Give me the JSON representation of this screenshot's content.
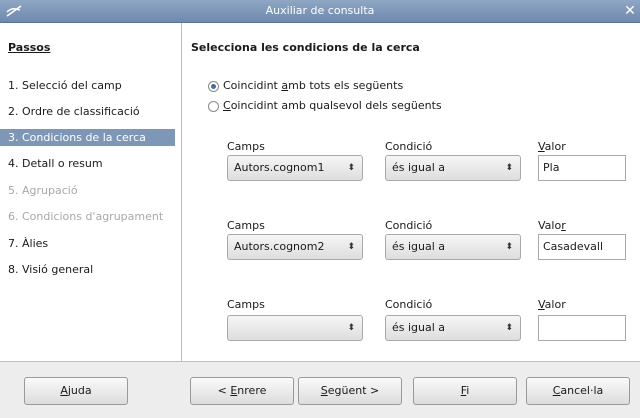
{
  "window": {
    "title": "Auxiliar de consulta",
    "close_glyph": "✕",
    "app_icon": "writer-icon"
  },
  "sidebar": {
    "heading": "Passos",
    "steps": [
      {
        "label": "1. Selecció del camp",
        "state": "normal"
      },
      {
        "label": "2. Ordre de classificació",
        "state": "normal"
      },
      {
        "label": "3. Condicions de la cerca",
        "state": "selected"
      },
      {
        "label": "4. Detall o resum",
        "state": "normal"
      },
      {
        "label": "5. Agrupació",
        "state": "disabled"
      },
      {
        "label": "6. Condicions d'agrupament",
        "state": "disabled"
      },
      {
        "label": "7. Àlies",
        "state": "normal"
      },
      {
        "label": "8. Visió general",
        "state": "normal"
      }
    ]
  },
  "main": {
    "heading": "Selecciona les condicions de la cerca",
    "match_all": {
      "pre": "Coincidint ",
      "key": "a",
      "post": "mb tots els següents",
      "selected": true
    },
    "match_any": {
      "pre": "",
      "key": "C",
      "post": "oincidint amb qualsevol dels següents",
      "selected": false
    },
    "rows": [
      {
        "field_label": "Camps",
        "condition_label": "Condició",
        "value_label_pre": "",
        "value_label_key": "V",
        "value_label_post": "alor",
        "field": "Autors.cognom1",
        "condition": "és igual a",
        "value": "Pla"
      },
      {
        "field_label": "Camps",
        "condition_label": "Condició",
        "value_label_pre": "Valo",
        "value_label_key": "r",
        "value_label_post": "",
        "field": "Autors.cognom2",
        "condition": "és igual a",
        "value": "Casadevall"
      },
      {
        "field_label": "Camps",
        "condition_label": "Condició",
        "value_label_pre": "",
        "value_label_key": "V",
        "value_label_post": "alor",
        "field": "",
        "condition": "és igual a",
        "value": ""
      }
    ],
    "spinner_glyph": "⬍"
  },
  "footer": {
    "help": {
      "pre": "",
      "key": "A",
      "post": "juda"
    },
    "back": {
      "pre": "< ",
      "key": "E",
      "post": "nrere"
    },
    "next": {
      "pre": "",
      "key": "S",
      "post": "egüent >"
    },
    "finish": {
      "pre": "",
      "key": "F",
      "post": "i"
    },
    "cancel": {
      "pre": "",
      "key": "C",
      "post": "ancel·la"
    }
  }
}
